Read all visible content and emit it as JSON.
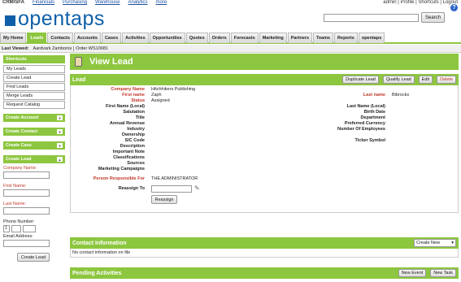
{
  "topnav": {
    "items": [
      "CRM/SFA",
      "Financials",
      "Purchasing",
      "Warehouse",
      "Analytics",
      "more"
    ]
  },
  "toplinks": "admin | Profile | Shortcuts | Logout",
  "logo": {
    "text": "opentaps"
  },
  "search": {
    "button": "Search",
    "placeholder": ""
  },
  "help_icon": "?",
  "tabs": [
    "My Home",
    "Leads",
    "Contacts",
    "Accounts",
    "Cases",
    "Activities",
    "Opportunities",
    "Quotes",
    "Orders",
    "Forecasts",
    "Marketing",
    "Partners",
    "Teams",
    "Reports",
    "opentaps"
  ],
  "active_tab": "Leads",
  "last_viewed": {
    "label": "Last Viewed:",
    "items": [
      "Aardvark Zambonis",
      "Order WS10081"
    ]
  },
  "sidebar": {
    "shortcuts_title": "Shortcuts",
    "shortcuts": [
      "My Leads",
      "Create Lead",
      "Find Leads",
      "Merge Leads",
      "Request Catalog"
    ],
    "sections": [
      "Create Account",
      "Create Contact",
      "Create Case",
      "Create Lead"
    ],
    "form": {
      "company_name": "Company Name:",
      "first_name": "First Name:",
      "last_name": "Last Name:",
      "phone_number": "Phone Number:",
      "phone_country": "1",
      "email": "Email Address:",
      "create_button": "Create Lead"
    }
  },
  "view_title": "View Lead",
  "lead_panel": {
    "title": "Lead",
    "buttons": [
      "Duplicate Lead",
      "Qualify Lead",
      "Edit",
      "Delete"
    ]
  },
  "lead_fields": {
    "company_name": {
      "label": "Company Name",
      "value": "Hitchhikers Publishing"
    },
    "first_name": {
      "label": "First name",
      "value": "Zaph"
    },
    "status": {
      "label": "Status",
      "value": "Assigned"
    },
    "first_name_local": {
      "label": "First Name (Local)",
      "value": ""
    },
    "salutation": {
      "label": "Salutation",
      "value": ""
    },
    "title": {
      "label": "Title",
      "value": ""
    },
    "annual_revenue": {
      "label": "Annual Revenue",
      "value": ""
    },
    "industry": {
      "label": "Industry",
      "value": ""
    },
    "ownership": {
      "label": "Ownership",
      "value": ""
    },
    "sic_code": {
      "label": "SIC Code",
      "value": ""
    },
    "description": {
      "label": "Description",
      "value": ""
    },
    "important_note": {
      "label": "Important Note",
      "value": ""
    },
    "classifications": {
      "label": "Classifications",
      "value": ""
    },
    "sources": {
      "label": "Sources",
      "value": ""
    },
    "marketing_campaigns": {
      "label": "Marketing Campaigns",
      "value": ""
    },
    "person_responsible": {
      "label": "Person Responsible For",
      "value": "THE ADMINISTRATOR"
    },
    "reassign_to": {
      "label": "Reassign To",
      "value": ""
    },
    "last_name": {
      "label": "Last name",
      "value": "Bibrocks"
    },
    "last_name_local": {
      "label": "Last Name (Local)",
      "value": ""
    },
    "birth_date": {
      "label": "Birth Date",
      "value": ""
    },
    "department": {
      "label": "Department",
      "value": ""
    },
    "preferred_currency": {
      "label": "Preferred Currency",
      "value": ""
    },
    "num_employees": {
      "label": "Number Of Employees",
      "value": ""
    },
    "ticker_symbol": {
      "label": "Ticker Symbol",
      "value": ""
    }
  },
  "reassign_button": "Reassign",
  "contact_panel": {
    "title": "Contact Information",
    "select_value": "Create New",
    "empty_text": "No contact information on file"
  },
  "pending_panel": {
    "title": "Pending Activities",
    "buttons": [
      "New Event",
      "New Task"
    ]
  },
  "colors": {
    "accent_green": "#8dc63f",
    "brand_blue": "#0f5fa8",
    "label_red": "#c0392b"
  }
}
